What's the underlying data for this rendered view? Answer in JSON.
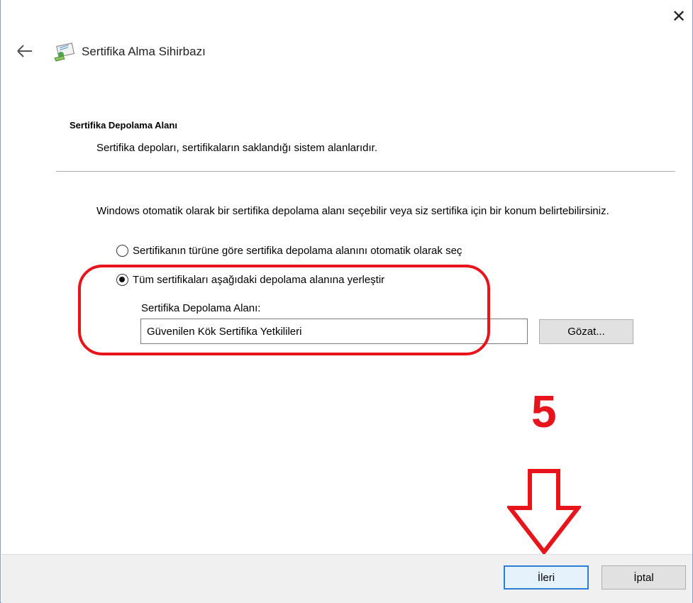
{
  "window": {
    "close_icon": "close-icon",
    "back_icon": "back-arrow-icon",
    "wizard_icon": "certificate-wizard-icon",
    "title": "Sertifika Alma Sihirbazı"
  },
  "header": {
    "section_title": "Sertifika Depolama Alanı",
    "section_desc": "Sertifika depoları, sertifikaların saklandığı sistem alanlarıdır."
  },
  "main": {
    "intro": "Windows otomatik olarak bir sertifika depolama alanı seçebilir veya siz sertifika için bir konum belirtebilirsiniz.",
    "option_auto": {
      "label": "Sertifikanın türüne göre sertifika depolama alanını otomatik olarak seç",
      "selected": false
    },
    "option_manual": {
      "label": "Tüm sertifikaları aşağıdaki depolama alanına yerleştir",
      "selected": true
    },
    "store_label": "Sertifika Depolama Alanı:",
    "store_value": "Güvenilen Kök Sertifika Yetkilileri",
    "browse_label": "Gözat..."
  },
  "annotation": {
    "step_number": "5",
    "color": "#e8141b"
  },
  "footer": {
    "next_label": "İleri",
    "cancel_label": "İptal"
  }
}
